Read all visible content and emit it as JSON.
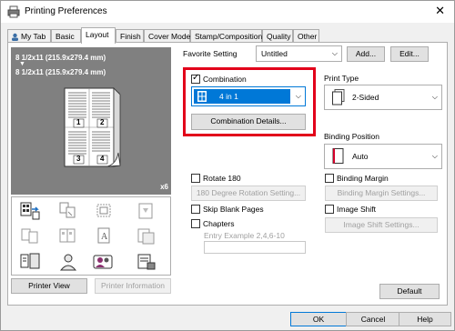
{
  "window": {
    "title": "Printing Preferences",
    "close_glyph": "✕"
  },
  "tabs": [
    {
      "label": "My Tab",
      "active": false
    },
    {
      "label": "Basic",
      "active": false
    },
    {
      "label": "Layout",
      "active": true
    },
    {
      "label": "Finish",
      "active": false
    },
    {
      "label": "Cover Mode",
      "active": false
    },
    {
      "label": "Stamp/Composition",
      "active": false
    },
    {
      "label": "Quality",
      "active": false
    },
    {
      "label": "Other",
      "active": false
    }
  ],
  "preview": {
    "size_line_1": "8 1/2x11 (215.9x279.4 mm)",
    "arrow": "▼",
    "size_line_2": "8 1/2x11 (215.9x279.4 mm)",
    "copies": "x6",
    "page_numbers": [
      "1",
      "2",
      "3",
      "4"
    ]
  },
  "printer_view_label": "Printer View",
  "printer_information_label": "Printer Information",
  "favorite": {
    "label": "Favorite Setting",
    "value": "Untitled",
    "add_label": "Add...",
    "edit_label": "Edit..."
  },
  "combination": {
    "label": "Combination",
    "checked": true,
    "value": "4 in 1",
    "details_label": "Combination Details..."
  },
  "print_type": {
    "label": "Print Type",
    "value": "2-Sided"
  },
  "binding_position": {
    "label": "Binding Position",
    "value": "Auto"
  },
  "rotate180": {
    "label": "Rotate 180",
    "checked": false,
    "settings_label": "180 Degree Rotation Setting..."
  },
  "skip_blank": {
    "label": "Skip Blank Pages",
    "checked": false
  },
  "chapters": {
    "label": "Chapters",
    "checked": false,
    "placeholder": "Entry Example 2,4,6-10"
  },
  "binding_margin": {
    "label": "Binding Margin",
    "checked": false,
    "settings_label": "Binding Margin Settings..."
  },
  "image_shift": {
    "label": "Image Shift",
    "checked": false,
    "settings_label": "Image Shift Settings..."
  },
  "default_label": "Default",
  "footer": {
    "ok": "OK",
    "cancel": "Cancel",
    "help": "Help"
  },
  "colors": {
    "highlight": "#e2001a",
    "select_accent": "#0078d7"
  }
}
